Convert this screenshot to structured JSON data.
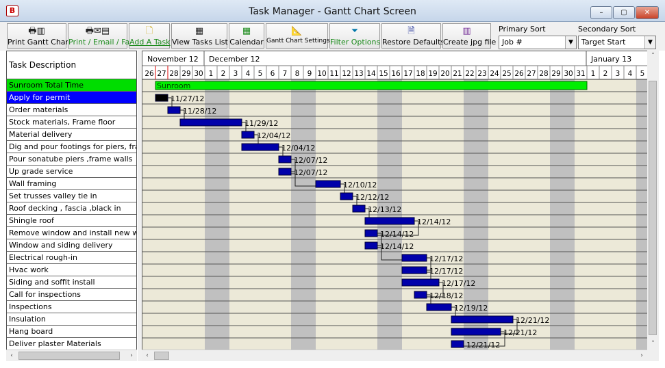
{
  "window": {
    "title": "Task Manager - Gantt Chart Screen",
    "app_icon": "app-icon",
    "controls": {
      "minimize": "–",
      "maximize": "▢",
      "close": "✕"
    }
  },
  "toolbar": {
    "buttons": [
      {
        "label": "Print Gantt Chart",
        "icon": "print-gantt-icon"
      },
      {
        "label": "Print / Email / Fax",
        "icon": "print-email-icon"
      },
      {
        "label": "Add A Task",
        "icon": "add-task-icon"
      },
      {
        "label": "View Tasks List",
        "icon": "grid-list-icon"
      },
      {
        "label": "Calendar",
        "icon": "calendar-icon"
      },
      {
        "label": "Gantt Chart Settings",
        "icon": "settings-icon"
      },
      {
        "label": "Filter Options",
        "icon": "filter-icon"
      },
      {
        "label": "Restore Defaults",
        "icon": "restore-icon"
      },
      {
        "label": "Create jpg file",
        "icon": "jpg-icon"
      }
    ],
    "primary_sort": {
      "label": "Primary Sort",
      "value": "Job #"
    },
    "secondary_sort": {
      "label": "Secondary Sort",
      "value": "Target Start"
    }
  },
  "task_list": {
    "header": "Task Description",
    "tasks": [
      "Sunroom Total Time",
      "Apply for permit",
      "Order materials",
      "Stock materials, Frame floor",
      "Material delivery",
      "Dig and pour footings for piers, fram...",
      "Pour sonatube piers ,frame walls",
      "Up grade service",
      "Wall framing",
      "Set trusses valley tie in",
      "Roof decking , fascia ,black in",
      "Shingle roof",
      "Remove window and install new wi...",
      "Window and siding delivery",
      "Electrical rough-in",
      "Hvac work",
      "Siding and soffit install",
      "Call for inspections",
      "Inspections",
      "Insulation",
      "Hang board",
      "Deliver plaster Materials"
    ]
  },
  "chart_data": {
    "type": "gantt",
    "months": [
      "November 12",
      "December 12",
      "January 13"
    ],
    "days": [
      "26",
      "27",
      "28",
      "29",
      "30",
      "1",
      "2",
      "3",
      "4",
      "5",
      "6",
      "7",
      "8",
      "9",
      "10",
      "11",
      "12",
      "13",
      "14",
      "15",
      "16",
      "17",
      "18",
      "19",
      "20",
      "21",
      "22",
      "23",
      "24",
      "25",
      "26",
      "27",
      "28",
      "29",
      "30",
      "31",
      "1",
      "2",
      "3",
      "4",
      "5"
    ],
    "first_day": "2012-11-26",
    "today": "2012-11-27",
    "summary": {
      "label": "Sunroom",
      "start": "2012-11-27",
      "end": "2013-01-01"
    },
    "bars": [
      {
        "start": "2012-11-27",
        "end": "2012-11-28",
        "label": "11/27/12",
        "status": "complete"
      },
      {
        "start": "2012-11-28",
        "end": "2012-11-29",
        "label": "11/28/12"
      },
      {
        "start": "2012-11-29",
        "end": "2012-12-04",
        "label": "11/29/12"
      },
      {
        "start": "2012-12-04",
        "end": "2012-12-05",
        "label": "12/04/12"
      },
      {
        "start": "2012-12-04",
        "end": "2012-12-07",
        "label": "12/04/12"
      },
      {
        "start": "2012-12-07",
        "end": "2012-12-08",
        "label": "12/07/12"
      },
      {
        "start": "2012-12-07",
        "end": "2012-12-08",
        "label": "12/07/12"
      },
      {
        "start": "2012-12-10",
        "end": "2012-12-12",
        "label": "12/10/12"
      },
      {
        "start": "2012-12-12",
        "end": "2012-12-13",
        "label": "12/12/12"
      },
      {
        "start": "2012-12-13",
        "end": "2012-12-14",
        "label": "12/13/12"
      },
      {
        "start": "2012-12-14",
        "end": "2012-12-18",
        "label": "12/14/12"
      },
      {
        "start": "2012-12-14",
        "end": "2012-12-15",
        "label": "12/14/12"
      },
      {
        "start": "2012-12-14",
        "end": "2012-12-15",
        "label": "12/14/12"
      },
      {
        "start": "2012-12-17",
        "end": "2012-12-19",
        "label": "12/17/12"
      },
      {
        "start": "2012-12-17",
        "end": "2012-12-19",
        "label": "12/17/12"
      },
      {
        "start": "2012-12-17",
        "end": "2012-12-20",
        "label": "12/17/12"
      },
      {
        "start": "2012-12-18",
        "end": "2012-12-19",
        "label": "12/18/12"
      },
      {
        "start": "2012-12-19",
        "end": "2012-12-21",
        "label": "12/19/12"
      },
      {
        "start": "2012-12-21",
        "end": "2012-12-26",
        "label": "12/21/12"
      },
      {
        "start": "2012-12-21",
        "end": "2012-12-25",
        "label": "12/21/12"
      },
      {
        "start": "2012-12-21",
        "end": "2012-12-22",
        "label": "12/21/12"
      }
    ]
  },
  "colors": {
    "summary_bar": "#00ee00",
    "task_bar": "#0000aa",
    "complete_bar": "#000000",
    "weekend": "#c0c0c0",
    "background": "#ece9d8",
    "selected_row": "#0000ff",
    "summary_row": "#00dd00",
    "today_line": "#dd0000"
  },
  "scroll": {
    "left": "‹",
    "right": "›",
    "up": "˄",
    "down": "˅"
  }
}
